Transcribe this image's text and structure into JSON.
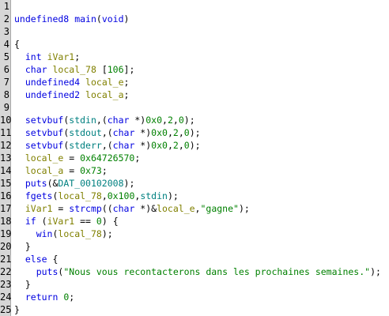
{
  "decompiler": {
    "colors": {
      "keyword": "#0000e0",
      "variable": "#808000",
      "number": "#008000",
      "global": "#008080",
      "string": "#008000"
    },
    "lines": [
      {
        "n": "1",
        "tokens": []
      },
      {
        "n": "2",
        "tokens": [
          [
            "undefined8",
            "type"
          ],
          [
            " ",
            "p"
          ],
          [
            "main",
            "fn"
          ],
          [
            "(",
            "p"
          ],
          [
            "void",
            "type"
          ],
          [
            ")",
            "p"
          ]
        ]
      },
      {
        "n": "3",
        "tokens": []
      },
      {
        "n": "4",
        "tokens": [
          [
            "{",
            "p"
          ]
        ]
      },
      {
        "n": "5",
        "tokens": [
          [
            "  ",
            "p"
          ],
          [
            "int",
            "type"
          ],
          [
            " ",
            "p"
          ],
          [
            "iVar1",
            "var"
          ],
          [
            ";",
            "p"
          ]
        ]
      },
      {
        "n": "6",
        "tokens": [
          [
            "  ",
            "p"
          ],
          [
            "char",
            "type"
          ],
          [
            " ",
            "p"
          ],
          [
            "local_78",
            "var"
          ],
          [
            " [",
            "p"
          ],
          [
            "106",
            "num"
          ],
          [
            "];",
            "p"
          ]
        ]
      },
      {
        "n": "7",
        "tokens": [
          [
            "  ",
            "p"
          ],
          [
            "undefined4",
            "type"
          ],
          [
            " ",
            "p"
          ],
          [
            "local_e",
            "var"
          ],
          [
            ";",
            "p"
          ]
        ]
      },
      {
        "n": "8",
        "tokens": [
          [
            "  ",
            "p"
          ],
          [
            "undefined2",
            "type"
          ],
          [
            " ",
            "p"
          ],
          [
            "local_a",
            "var"
          ],
          [
            ";",
            "p"
          ]
        ]
      },
      {
        "n": "9",
        "tokens": []
      },
      {
        "n": "10",
        "tokens": [
          [
            "  ",
            "p"
          ],
          [
            "setvbuf",
            "fn"
          ],
          [
            "(",
            "p"
          ],
          [
            "stdin",
            "glob"
          ],
          [
            ",(",
            "p"
          ],
          [
            "char",
            "type"
          ],
          [
            " *)",
            "p"
          ],
          [
            "0x0",
            "num"
          ],
          [
            ",",
            "p"
          ],
          [
            "2",
            "num"
          ],
          [
            ",",
            "p"
          ],
          [
            "0",
            "num"
          ],
          [
            ");",
            "p"
          ]
        ]
      },
      {
        "n": "11",
        "tokens": [
          [
            "  ",
            "p"
          ],
          [
            "setvbuf",
            "fn"
          ],
          [
            "(",
            "p"
          ],
          [
            "stdout",
            "glob"
          ],
          [
            ",(",
            "p"
          ],
          [
            "char",
            "type"
          ],
          [
            " *)",
            "p"
          ],
          [
            "0x0",
            "num"
          ],
          [
            ",",
            "p"
          ],
          [
            "2",
            "num"
          ],
          [
            ",",
            "p"
          ],
          [
            "0",
            "num"
          ],
          [
            ");",
            "p"
          ]
        ]
      },
      {
        "n": "12",
        "tokens": [
          [
            "  ",
            "p"
          ],
          [
            "setvbuf",
            "fn"
          ],
          [
            "(",
            "p"
          ],
          [
            "stderr",
            "glob"
          ],
          [
            ",(",
            "p"
          ],
          [
            "char",
            "type"
          ],
          [
            " *)",
            "p"
          ],
          [
            "0x0",
            "num"
          ],
          [
            ",",
            "p"
          ],
          [
            "2",
            "num"
          ],
          [
            ",",
            "p"
          ],
          [
            "0",
            "num"
          ],
          [
            ");",
            "p"
          ]
        ]
      },
      {
        "n": "13",
        "tokens": [
          [
            "  ",
            "p"
          ],
          [
            "local_e",
            "var"
          ],
          [
            " = ",
            "p"
          ],
          [
            "0x64726570",
            "num"
          ],
          [
            ";",
            "p"
          ]
        ]
      },
      {
        "n": "14",
        "tokens": [
          [
            "  ",
            "p"
          ],
          [
            "local_a",
            "var"
          ],
          [
            " = ",
            "p"
          ],
          [
            "0x73",
            "num"
          ],
          [
            ";",
            "p"
          ]
        ]
      },
      {
        "n": "15",
        "tokens": [
          [
            "  ",
            "p"
          ],
          [
            "puts",
            "fn"
          ],
          [
            "(&",
            "p"
          ],
          [
            "DAT_00102008",
            "glob"
          ],
          [
            ");",
            "p"
          ]
        ]
      },
      {
        "n": "16",
        "tokens": [
          [
            "  ",
            "p"
          ],
          [
            "fgets",
            "fn"
          ],
          [
            "(",
            "p"
          ],
          [
            "local_78",
            "var"
          ],
          [
            ",",
            "p"
          ],
          [
            "0x100",
            "num"
          ],
          [
            ",",
            "p"
          ],
          [
            "stdin",
            "glob"
          ],
          [
            ");",
            "p"
          ]
        ]
      },
      {
        "n": "17",
        "tokens": [
          [
            "  ",
            "p"
          ],
          [
            "iVar1",
            "var"
          ],
          [
            " = ",
            "p"
          ],
          [
            "strcmp",
            "fn"
          ],
          [
            "((",
            "p"
          ],
          [
            "char",
            "type"
          ],
          [
            " *)&",
            "p"
          ],
          [
            "local_e",
            "var"
          ],
          [
            ",",
            "p"
          ],
          [
            "\"gagne\"",
            "str"
          ],
          [
            ");",
            "p"
          ]
        ]
      },
      {
        "n": "18",
        "tokens": [
          [
            "  ",
            "p"
          ],
          [
            "if",
            "kw"
          ],
          [
            " (",
            "p"
          ],
          [
            "iVar1",
            "var"
          ],
          [
            " == ",
            "p"
          ],
          [
            "0",
            "num"
          ],
          [
            ") {",
            "p"
          ]
        ]
      },
      {
        "n": "19",
        "tokens": [
          [
            "    ",
            "p"
          ],
          [
            "win",
            "fn"
          ],
          [
            "(",
            "p"
          ],
          [
            "local_78",
            "var"
          ],
          [
            ");",
            "p"
          ]
        ]
      },
      {
        "n": "20",
        "tokens": [
          [
            "  }",
            "p"
          ]
        ]
      },
      {
        "n": "21",
        "tokens": [
          [
            "  ",
            "p"
          ],
          [
            "else",
            "kw"
          ],
          [
            " {",
            "p"
          ]
        ]
      },
      {
        "n": "22",
        "tokens": [
          [
            "    ",
            "p"
          ],
          [
            "puts",
            "fn"
          ],
          [
            "(",
            "p"
          ],
          [
            "\"Nous vous recontacterons dans les prochaines semaines.\"",
            "str"
          ],
          [
            ");",
            "p"
          ]
        ]
      },
      {
        "n": "23",
        "tokens": [
          [
            "  }",
            "p"
          ]
        ]
      },
      {
        "n": "24",
        "tokens": [
          [
            "  ",
            "p"
          ],
          [
            "return",
            "kw"
          ],
          [
            " ",
            "p"
          ],
          [
            "0",
            "num"
          ],
          [
            ";",
            "p"
          ]
        ]
      },
      {
        "n": "25",
        "tokens": [
          [
            "}",
            "p"
          ]
        ]
      }
    ]
  }
}
